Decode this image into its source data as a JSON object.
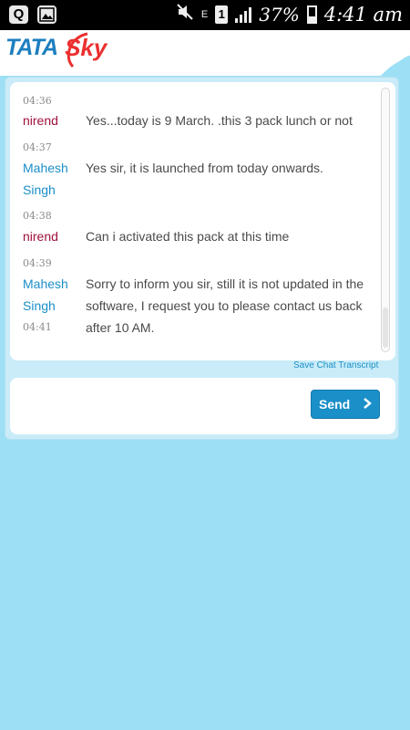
{
  "status_bar": {
    "left_icons": [
      "Q",
      "image-icon"
    ],
    "sim_label": "1",
    "network_label": "E",
    "battery_percent": "37%",
    "battery_level": 0.37,
    "time": "4:41 am"
  },
  "header": {
    "logo_tata": "TATA",
    "logo_sky": "Sky",
    "accent_color": "#ec2f2f",
    "brand_color": "#1d7fc0"
  },
  "chat": {
    "messages": [
      {
        "ts_before": "04:36",
        "sender": "nirend",
        "role": "user",
        "text": "Yes...today is 9 March. .this 3 pack lunch or not"
      },
      {
        "ts_before": "04:37",
        "sender": "Mahesh Singh",
        "role": "agent",
        "text": "Yes sir, it is launched from today onwards."
      },
      {
        "ts_before": "04:38",
        "sender": "nirend",
        "role": "user",
        "text": "Can i activated this pack at this time"
      },
      {
        "ts_before": "04:39",
        "sender": "Mahesh Singh",
        "role": "agent",
        "text": "Sorry to inform you sir, still it is not updated in the software, I request you to please contact us back after 10 AM."
      }
    ],
    "last_ts": "04:41",
    "save_transcript_label": "Save Chat Transcript"
  },
  "compose": {
    "send_label": "Send",
    "input_value": ""
  }
}
